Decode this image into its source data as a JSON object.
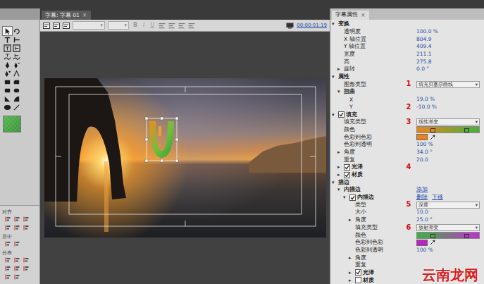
{
  "titleTab": {
    "label": "字幕: 字幕 01",
    "close": "×"
  },
  "propsTab": {
    "label": "字幕属性",
    "close": "×"
  },
  "glyphs": {
    "expanded": "▾",
    "collapsed": "▸",
    "dropdown": "▾"
  },
  "tools": [
    {
      "kind": "select",
      "selected": true
    },
    {
      "kind": "rotate",
      "selected": false
    },
    {
      "kind": "type",
      "selected": false
    },
    {
      "kind": "vtype",
      "selected": false
    },
    {
      "kind": "areatype",
      "selected": false
    },
    {
      "kind": "vareatype",
      "selected": false
    },
    {
      "kind": "pathtype",
      "selected": false
    },
    {
      "kind": "vpathtype",
      "selected": false
    },
    {
      "kind": "pen",
      "selected": false
    },
    {
      "kind": "deleteanchor",
      "selected": false
    },
    {
      "kind": "addanchor",
      "selected": false
    },
    {
      "kind": "convertanchor",
      "selected": false
    },
    {
      "kind": "rect",
      "selected": false
    },
    {
      "kind": "cliprect",
      "selected": false
    },
    {
      "kind": "roundrect",
      "selected": false
    },
    {
      "kind": "roundcorner",
      "selected": false
    },
    {
      "kind": "wedge",
      "selected": false
    },
    {
      "kind": "arc",
      "selected": false
    },
    {
      "kind": "ellipse",
      "selected": false
    },
    {
      "kind": "line",
      "selected": false
    }
  ],
  "alignPanel": {
    "sections": [
      {
        "label": "对齐"
      },
      {
        "label": "居中"
      },
      {
        "label": "分布"
      }
    ]
  },
  "toolbar": {
    "styleButtons": [
      {
        "glyph": "B",
        "disabled": true
      },
      {
        "glyph": "I",
        "disabled": true
      },
      {
        "glyph": "U",
        "disabled": true
      }
    ],
    "timecode": "00:00:01:19"
  },
  "properties": [
    {
      "kind": "group",
      "label": "变换",
      "indent": 0,
      "expanded": true
    },
    {
      "kind": "value",
      "label": "透明度",
      "indent": 1,
      "value": "100.0 %"
    },
    {
      "kind": "value",
      "label": "X 轴位置",
      "indent": 1,
      "value": "804.9"
    },
    {
      "kind": "value",
      "label": "Y 轴位置",
      "indent": 1,
      "value": "409.4"
    },
    {
      "kind": "value",
      "label": "宽度",
      "indent": 1,
      "value": "211.1"
    },
    {
      "kind": "value",
      "label": "高",
      "indent": 1,
      "value": "275.8"
    },
    {
      "kind": "value",
      "label": "旋转",
      "indent": 1,
      "expanded": false,
      "value": "0.0 °"
    },
    {
      "kind": "group",
      "label": "属性",
      "indent": 0,
      "expanded": true
    },
    {
      "kind": "dropdown",
      "label": "图形类型",
      "indent": 1,
      "value": "填充贝塞尔曲线",
      "marker": "1"
    },
    {
      "kind": "group",
      "label": "扭曲",
      "indent": 1,
      "expanded": true
    },
    {
      "kind": "value",
      "label": "X",
      "indent": 2,
      "value": "19.0 %"
    },
    {
      "kind": "value",
      "label": "Y",
      "indent": 2,
      "value": "-10.0 %",
      "marker": "2"
    },
    {
      "kind": "group",
      "label": "填充",
      "indent": 0,
      "expanded": true,
      "checked": true
    },
    {
      "kind": "dropdown",
      "label": "填充类型",
      "indent": 1,
      "value": "线性渐变",
      "marker": "3"
    },
    {
      "kind": "gradient",
      "label": "颜色",
      "indent": 1,
      "colors": [
        "#e8861e",
        "#47b23a"
      ]
    },
    {
      "kind": "swatch",
      "label": "色彩到色彩",
      "indent": 1,
      "color": "#e8821e"
    },
    {
      "kind": "value",
      "label": "色彩到透明",
      "indent": 1,
      "value": "100 %"
    },
    {
      "kind": "value",
      "label": "角度",
      "indent": 1,
      "expanded": false,
      "value": "34.0 °"
    },
    {
      "kind": "value",
      "label": "重复",
      "indent": 1,
      "value": "20.0"
    },
    {
      "kind": "group",
      "label": "光泽",
      "indent": 1,
      "expanded": false,
      "checked": true,
      "marker": "4"
    },
    {
      "kind": "group",
      "label": "材质",
      "indent": 1,
      "expanded": false,
      "checked": true
    },
    {
      "kind": "group",
      "label": "描边",
      "indent": 0,
      "expanded": true
    },
    {
      "kind": "group",
      "label": "内描边",
      "indent": 1,
      "expanded": true,
      "actions": [
        "添加"
      ]
    },
    {
      "kind": "group",
      "label": "内描边",
      "indent": 2,
      "expanded": true,
      "checked": true,
      "actions": [
        "删除",
        "下移"
      ]
    },
    {
      "kind": "dropdown",
      "label": "类型",
      "indent": 3,
      "value": "深度",
      "marker": "5"
    },
    {
      "kind": "value",
      "label": "大小",
      "indent": 3,
      "value": "10.0"
    },
    {
      "kind": "value",
      "label": "角度",
      "indent": 3,
      "expanded": false,
      "value": "25.0 °"
    },
    {
      "kind": "dropdown",
      "label": "填充类型",
      "indent": 3,
      "value": "放射渐变",
      "marker": "6"
    },
    {
      "kind": "gradient",
      "label": "颜色",
      "indent": 3,
      "colors": [
        "#3cb43c",
        "#c030d0"
      ]
    },
    {
      "kind": "swatch",
      "label": "色彩到色彩",
      "indent": 3,
      "color": "#c020c8"
    },
    {
      "kind": "value",
      "label": "色彩到透明",
      "indent": 3,
      "value": "100 %"
    },
    {
      "kind": "value",
      "label": "角度",
      "indent": 3,
      "expanded": false
    },
    {
      "kind": "value",
      "label": "重复",
      "indent": 3
    },
    {
      "kind": "group",
      "label": "光泽",
      "indent": 3,
      "expanded": false,
      "checked": true
    },
    {
      "kind": "group",
      "label": "材质",
      "indent": 3,
      "expanded": false,
      "checked": false
    }
  ],
  "watermark": "云南龙网"
}
